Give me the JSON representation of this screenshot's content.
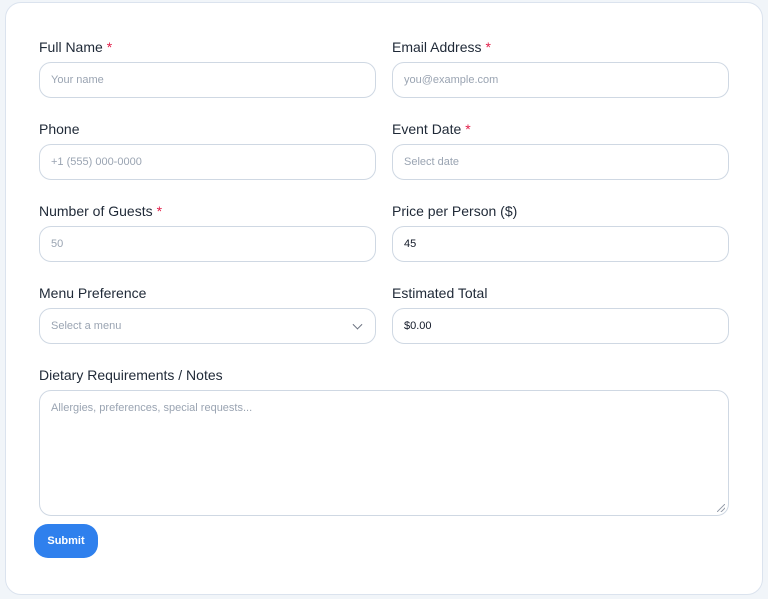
{
  "form": {
    "full_name": {
      "label": "Full Name",
      "required_mark": "*",
      "placeholder": "Your name",
      "value": ""
    },
    "email": {
      "label": "Email Address",
      "required_mark": "*",
      "placeholder": "you@example.com",
      "value": ""
    },
    "phone": {
      "label": "Phone",
      "placeholder": "+1 (555) 000-0000",
      "value": ""
    },
    "event_date": {
      "label": "Event Date",
      "required_mark": "*",
      "placeholder": "Select date",
      "value": ""
    },
    "guests": {
      "label": "Number of Guests",
      "required_mark": "*",
      "placeholder": "50",
      "value": ""
    },
    "price_per_person": {
      "label": "Price per Person ($)",
      "value": "45"
    },
    "menu": {
      "label": "Menu Preference",
      "selected": "Select a menu",
      "icon": "chevron-down-icon"
    },
    "estimated_total": {
      "label": "Estimated Total",
      "value": "$0.00"
    },
    "notes": {
      "label": "Dietary Requirements / Notes",
      "placeholder": "Allergies, preferences, special requests..."
    },
    "submit_label": "Submit"
  },
  "colors": {
    "accent": "#2f80ed",
    "required": "#e11d48",
    "border": "#cfd8e3",
    "placeholder": "#9aa4b2"
  }
}
